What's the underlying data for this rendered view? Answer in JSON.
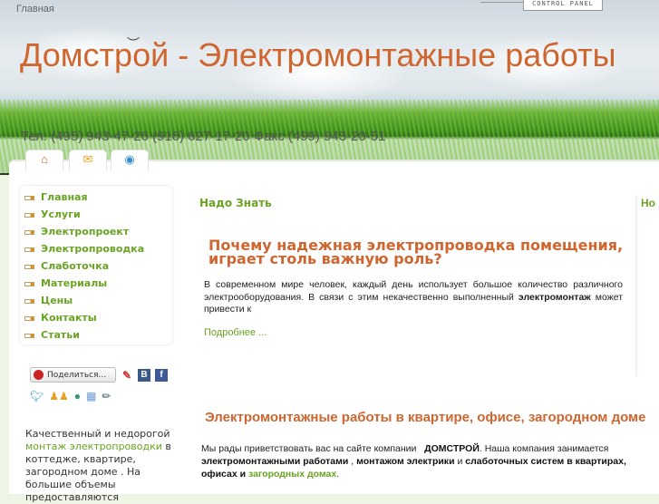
{
  "breadcrumb": "Главная",
  "control_panel": "CONTROL PANEL",
  "site_title": "Домстрой - Электромонтажные работы",
  "phone": "Тел. (495) 943-47-26 (916) 627-17-20   Факс (499) 943-20-51",
  "tabs": [
    {
      "icon": "home-icon",
      "glyph": "⌂"
    },
    {
      "icon": "mail-icon",
      "glyph": "✉"
    },
    {
      "icon": "globe-icon",
      "glyph": "◉"
    }
  ],
  "menu": [
    "Главная",
    "Услуги",
    "Электропроект",
    "Электропроводка",
    "Слаботочка",
    "Материалы",
    "Цены",
    "Контакты",
    "Статьи"
  ],
  "share": {
    "label": "Поделиться...",
    "vk": "B",
    "fb": "f"
  },
  "side_text": {
    "before": "Качественный и недорогой ",
    "link": "монтаж электропроводки",
    "after": "  в коттедже, квартире, загородном доме . На большие объемы предоставляются"
  },
  "column_title": "Надо Знать",
  "column2_title": "Но",
  "article1": {
    "title": "Почему надежная электропроводка помещения, играет столь важную роль?",
    "text": "В современном мире человек, каждый день использует большое количество различного электрооборудования. В связи с этим некачественно выполненный",
    "bold": "электромонтаж",
    "text2": "может привести к",
    "more": "Подробнее ..."
  },
  "article2": {
    "title": "Электромонтажные работы в квартире, офисе, загородном доме",
    "t1": "Мы рады приветствовать вас на сайте компании",
    "company": "ДОМСТРОЙ",
    "t2": ". Наша компания занимается",
    "b1": "электромонтажными работами",
    "t3": " ,  ",
    "b2": "монтажом электрики",
    "t4": "  и  ",
    "b3": "слаботочных систем в квартирах,",
    "b4": "офисах и ",
    "link": "загородных домах",
    "t5": "."
  },
  "colors": {
    "accent_orange": "#cf6630",
    "accent_green": "#6aa323"
  }
}
